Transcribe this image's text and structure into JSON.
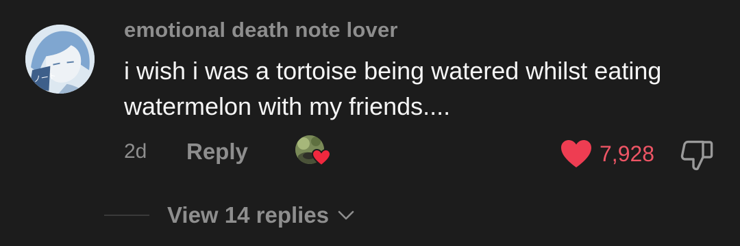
{
  "comment": {
    "username": "emotional death note lover",
    "text": "i wish i was a tortoise being watered whilst eating watermelon with my friends....",
    "timestamp": "2d",
    "reply_label": "Reply",
    "like_count": "7,928",
    "liked": true,
    "creator_liked": true,
    "avatar_icon": "anime-character-avatar",
    "like_icon": "heart-icon",
    "dislike_icon": "thumbs-down-icon"
  },
  "replies": {
    "label": "View 14 replies",
    "icon": "chevron-down-icon"
  },
  "colors": {
    "background": "#1c1c1c",
    "muted_text": "#8e8e8e",
    "primary_text": "#f5f5f5",
    "like_red": "#ee5565"
  }
}
